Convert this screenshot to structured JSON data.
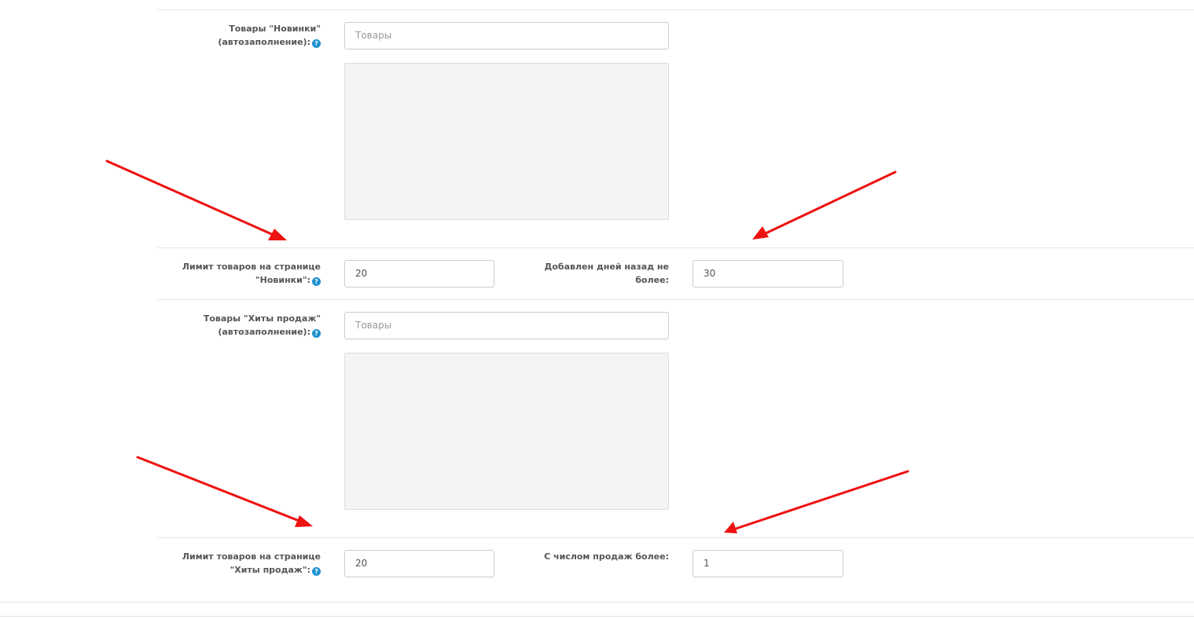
{
  "featured_new": {
    "label_line1": "Товары \"Новинки\"",
    "label_line2": "(автозаполнение):",
    "input_placeholder": "Товары"
  },
  "limit_new": {
    "label_line1": "Лимит товаров на странице",
    "label_line2": "\"Новинки\":",
    "value": "20"
  },
  "days_added": {
    "label_line1": "Добавлен дней назад не",
    "label_line2": "более:",
    "value": "30"
  },
  "featured_bestsellers": {
    "label_line1": "Товары \"Хиты продаж\"",
    "label_line2": "(автозаполнение):",
    "input_placeholder": "Товары"
  },
  "limit_bestsellers": {
    "label_line1": "Лимит товаров на странице",
    "label_line2": "\"Хиты продаж\":",
    "value": "20"
  },
  "min_sales": {
    "label": "С числом продаж более:",
    "value": "1"
  },
  "help_icon_glyph": "?",
  "colors": {
    "arrow": "#ee1111",
    "help_icon": "#1e91cf",
    "label_text": "#555555"
  }
}
